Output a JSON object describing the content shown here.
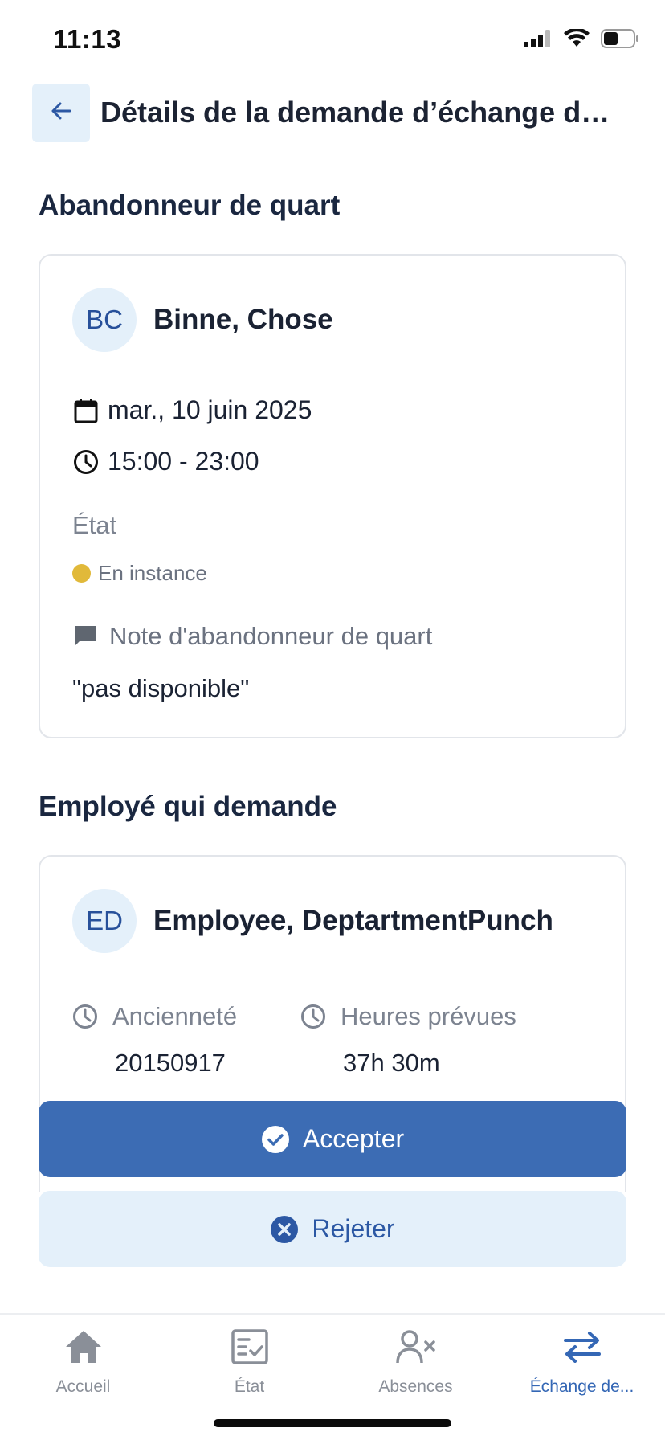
{
  "status_bar": {
    "time": "11:13"
  },
  "header": {
    "title": "Détails de la demande d’échange de..."
  },
  "giver_section": {
    "title": "Abandonneur de quart",
    "avatar_initials": "BC",
    "name": "Binne, Chose",
    "date": "mar., 10 juin 2025",
    "time_range": "15:00 - 23:00",
    "state_label": "État",
    "state_value": "En instance",
    "note_label": "Note d'abandonneur de quart",
    "note_text": "\"pas disponible\""
  },
  "requester_section": {
    "title": "Employé qui demande",
    "avatar_initials": "ED",
    "name": "Employee, DeptartmentPunch",
    "seniority_label": "Ancienneté",
    "seniority_value": "20150917",
    "hours_label": "Heures prévues",
    "hours_value": "37h 30m"
  },
  "actions": {
    "accept_label": "Accepter",
    "reject_label": "Rejeter"
  },
  "tabs": [
    {
      "label": "Accueil",
      "icon": "home-icon"
    },
    {
      "label": "État",
      "icon": "checklist-icon"
    },
    {
      "label": "Absences",
      "icon": "person-x-icon"
    },
    {
      "label": "Échange de...",
      "icon": "swap-arrows-icon",
      "active": true
    }
  ],
  "colors": {
    "primary": "#3c6cb4",
    "primary_light": "#e4f0fa",
    "status_pending": "#e1b93a",
    "text_dark": "#1a2233",
    "text_muted": "#7c8390"
  }
}
